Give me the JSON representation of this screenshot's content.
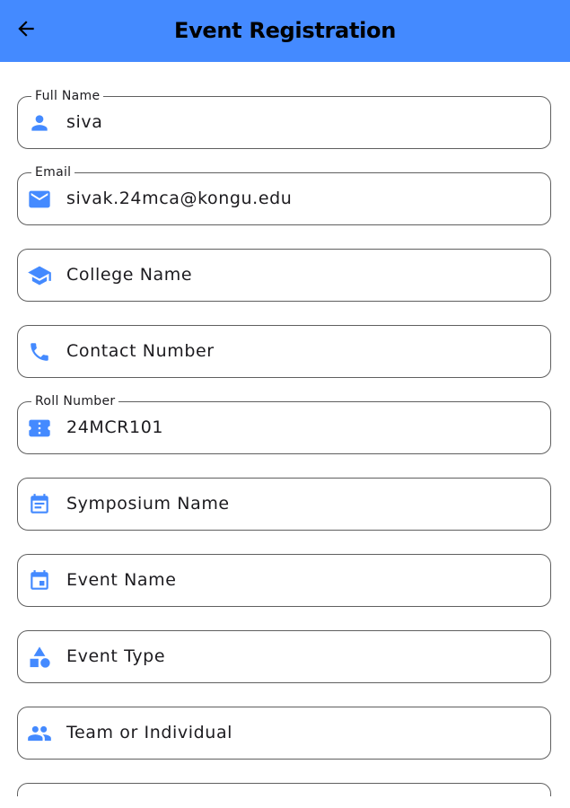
{
  "appbar": {
    "title": "Event Registration",
    "back_icon": "arrow-back-icon",
    "background": "#448aff"
  },
  "accent_color": "#448aff",
  "form": {
    "full_name": {
      "label": "Full Name",
      "value": "siva",
      "icon": "person-icon"
    },
    "email": {
      "label": "Email",
      "value": "sivak.24mca@kongu.edu",
      "icon": "mail-icon"
    },
    "college_name": {
      "placeholder": "College Name",
      "icon": "school-icon"
    },
    "contact_number": {
      "placeholder": "Contact Number",
      "icon": "phone-icon"
    },
    "roll_number": {
      "label": "Roll Number",
      "value": "24MCR101",
      "icon": "ticket-icon"
    },
    "symposium_name": {
      "placeholder": "Symposium Name",
      "icon": "event-note-icon"
    },
    "event_name": {
      "placeholder": "Event Name",
      "icon": "event-icon"
    },
    "event_type": {
      "placeholder": "Event Type",
      "icon": "category-icon"
    },
    "team_or_individual": {
      "placeholder": "Team or Individual",
      "icon": "group-icon"
    }
  }
}
